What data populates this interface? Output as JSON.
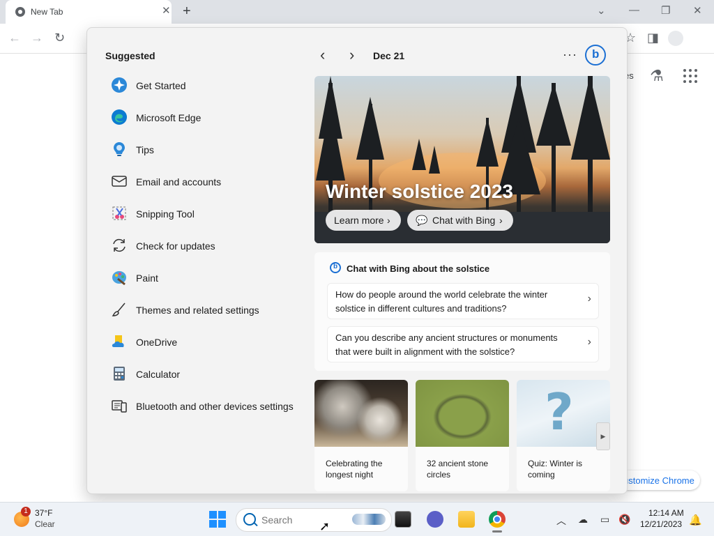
{
  "browser": {
    "tab_title": "New Tab",
    "page_right_text": "es",
    "customize_label": "ustomize Chrome"
  },
  "start_menu": {
    "suggested_title": "Suggested",
    "apps": [
      {
        "label": "Get Started",
        "icon": "get-started-icon"
      },
      {
        "label": "Microsoft Edge",
        "icon": "edge-icon"
      },
      {
        "label": "Tips",
        "icon": "tips-icon"
      },
      {
        "label": "Email and accounts",
        "icon": "mail-icon"
      },
      {
        "label": "Snipping Tool",
        "icon": "snipping-tool-icon"
      },
      {
        "label": "Check for updates",
        "icon": "refresh-icon"
      },
      {
        "label": "Paint",
        "icon": "paint-icon"
      },
      {
        "label": "Themes and related settings",
        "icon": "brush-icon"
      },
      {
        "label": "OneDrive",
        "icon": "onedrive-icon"
      },
      {
        "label": "Calculator",
        "icon": "calculator-icon"
      },
      {
        "label": "Bluetooth and other devices settings",
        "icon": "devices-icon"
      }
    ]
  },
  "widget": {
    "date": "Dec 21",
    "more_label": "···",
    "hero": {
      "title": "Winter solstice 2023",
      "learn_more": "Learn more",
      "chat_with_bing": "Chat with Bing"
    },
    "chat": {
      "heading": "Chat with Bing about the solstice",
      "questions": [
        "How do people around the world celebrate the winter solstice in different cultures and traditions?",
        "Can you describe any ancient structures or monuments that were built in alignment with the solstice?"
      ]
    },
    "news": [
      {
        "caption": "Celebrating the longest night"
      },
      {
        "caption": "32 ancient stone circles"
      },
      {
        "caption": "Quiz: Winter is coming"
      }
    ]
  },
  "taskbar": {
    "weather_badge": "1",
    "temperature": "37°F",
    "condition": "Clear",
    "search_placeholder": "Search",
    "time": "12:14 AM",
    "date": "12/21/2023"
  },
  "colors": {
    "accent": "#1b6fd3",
    "panel_bg": "#f3f3f3",
    "chrome_tabstrip": "#dee1e6"
  }
}
